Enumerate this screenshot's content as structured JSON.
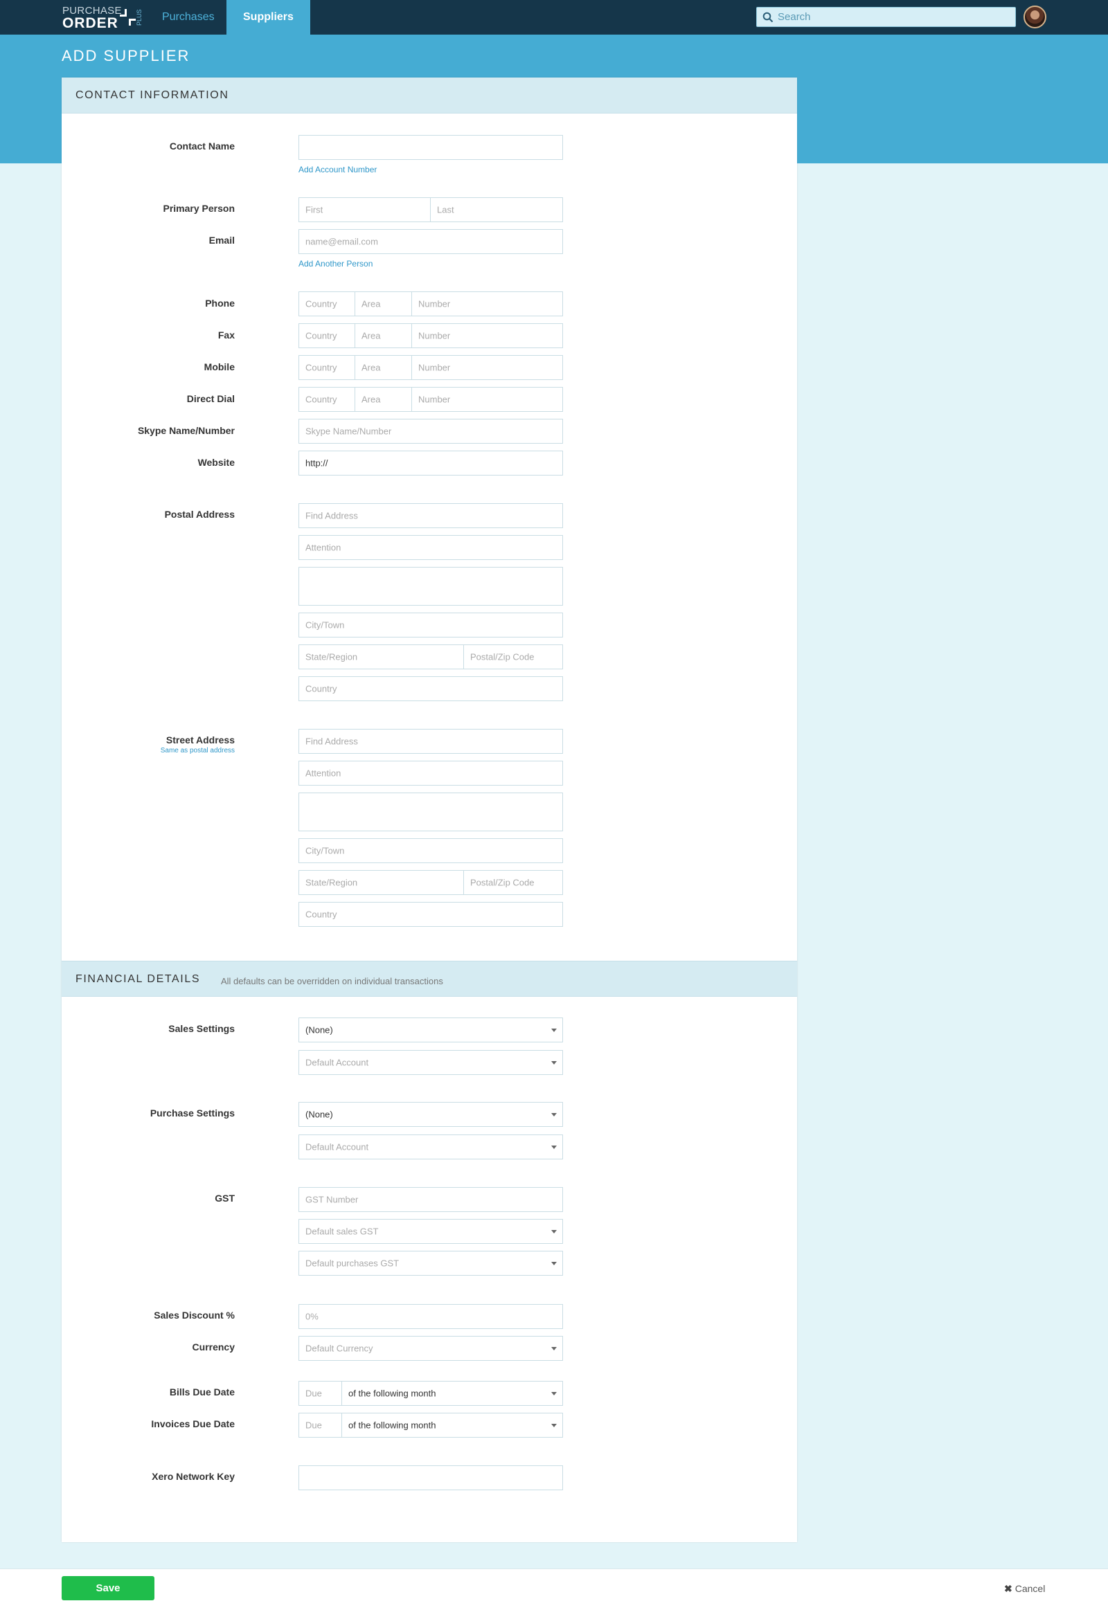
{
  "app": {
    "logo_line1": "PURCHASE",
    "logo_line2": "ORDER",
    "logo_plus": "PLUS",
    "nav": {
      "purchases": "Purchases",
      "suppliers": "Suppliers"
    },
    "search_placeholder": "Search",
    "icons": {
      "search": "search-icon",
      "avatar": "user-avatar"
    }
  },
  "page": {
    "title": "ADD SUPPLIER"
  },
  "contact": {
    "section_title": "CONTACT INFORMATION",
    "contact_name_label": "Contact Name",
    "contact_name_value": "",
    "add_account_number": "Add Account Number",
    "primary_person_label": "Primary Person",
    "first_placeholder": "First",
    "last_placeholder": "Last",
    "email_label": "Email",
    "email_placeholder": "name@email.com",
    "add_another_person": "Add Another Person",
    "phone_rows": [
      {
        "label": "Phone",
        "country": "Country",
        "area": "Area",
        "number": "Number"
      },
      {
        "label": "Fax",
        "country": "Country",
        "area": "Area",
        "number": "Number"
      },
      {
        "label": "Mobile",
        "country": "Country",
        "area": "Area",
        "number": "Number"
      },
      {
        "label": "Direct Dial",
        "country": "Country",
        "area": "Area",
        "number": "Number"
      }
    ],
    "skype_label": "Skype Name/Number",
    "skype_placeholder": "Skype Name/Number",
    "website_label": "Website",
    "website_value": "http://",
    "postal": {
      "label": "Postal Address",
      "find_address": "Find Address",
      "attention": "Attention",
      "city": "City/Town",
      "state": "State/Region",
      "zip": "Postal/Zip Code",
      "country": "Country"
    },
    "street": {
      "label": "Street Address",
      "same_as_postal": "Same as postal address",
      "find_address": "Find Address",
      "attention": "Attention",
      "city": "City/Town",
      "state": "State/Region",
      "zip": "Postal/Zip Code",
      "country": "Country"
    }
  },
  "financial": {
    "section_title": "FINANCIAL DETAILS",
    "section_subtitle": "All defaults can be overridden on individual transactions",
    "sales_settings_label": "Sales Settings",
    "sales_settings_value": "(None)",
    "sales_default_account": "Default Account",
    "purchase_settings_label": "Purchase Settings",
    "purchase_settings_value": "(None)",
    "purchase_default_account": "Default Account",
    "gst_label": "GST",
    "gst_number_placeholder": "GST Number",
    "default_sales_gst": "Default sales GST",
    "default_purchases_gst": "Default purchases GST",
    "sales_discount_label": "Sales Discount %",
    "sales_discount_placeholder": "0%",
    "currency_label": "Currency",
    "currency_value": "Default Currency",
    "bills_due_label": "Bills Due Date",
    "bills_due_placeholder": "Due",
    "bills_due_option": "of the following month",
    "invoices_due_label": "Invoices Due Date",
    "invoices_due_placeholder": "Due",
    "invoices_due_option": "of the following month",
    "xero_key_label": "Xero Network Key",
    "xero_key_value": ""
  },
  "footer": {
    "save": "Save",
    "cancel": "Cancel",
    "cancel_icon": "✖"
  }
}
